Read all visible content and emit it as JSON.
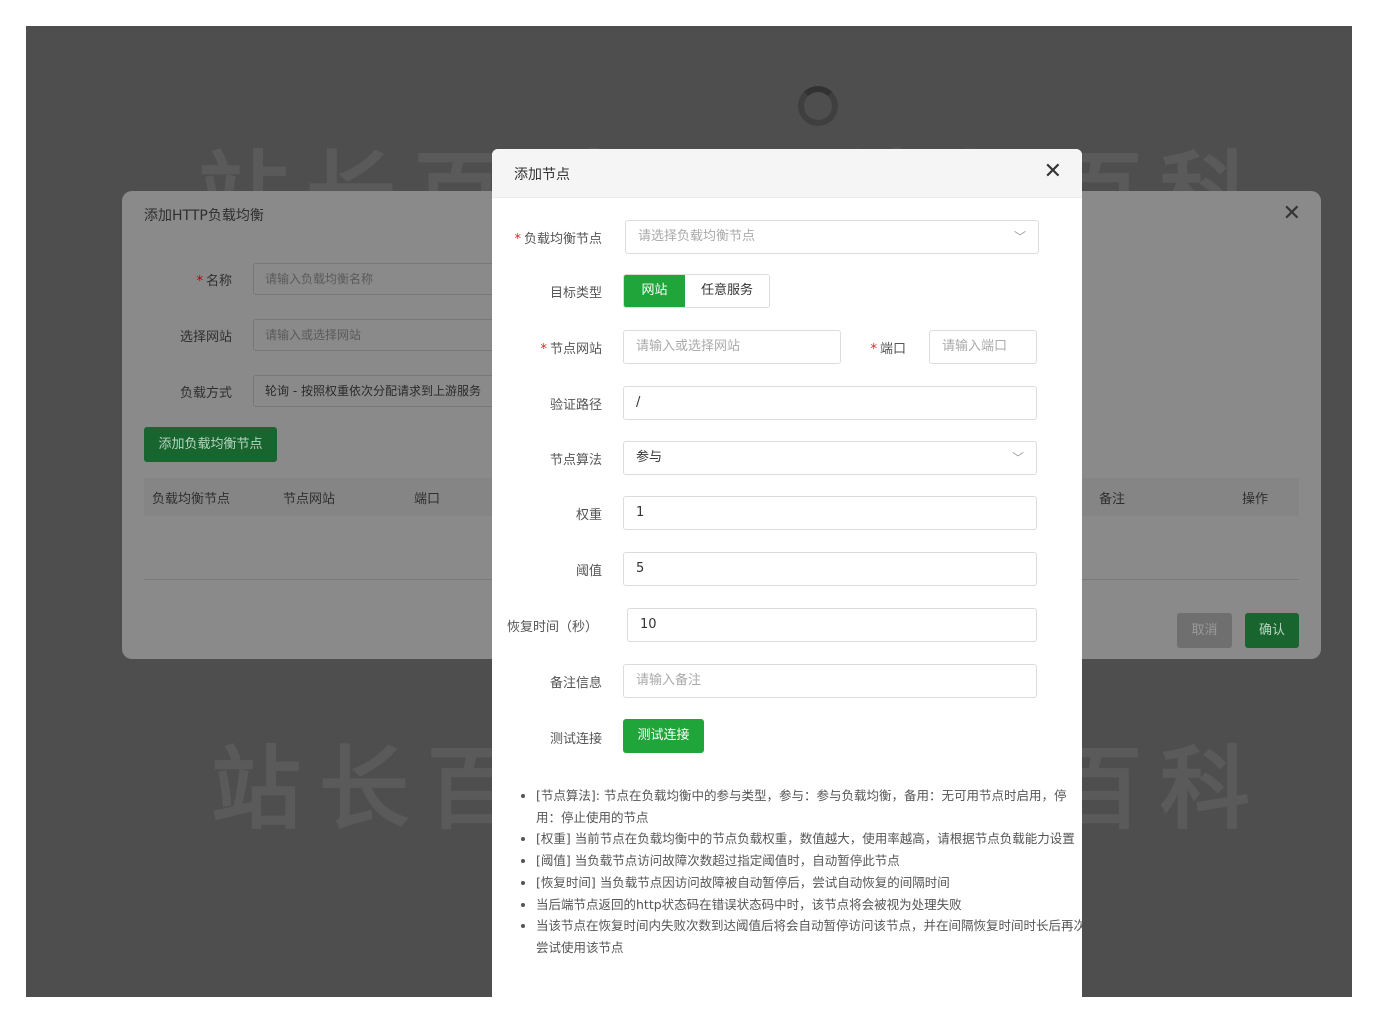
{
  "watermark": "站长百科",
  "back_dialog": {
    "title": "添加HTTP负载均衡",
    "fields": [
      {
        "label": "名称",
        "required": true,
        "placeholder": "请输入负载均衡名称",
        "value": ""
      },
      {
        "label": "选择网站",
        "required": false,
        "placeholder": "请输入或选择网站",
        "value": ""
      },
      {
        "label": "负载方式",
        "required": false,
        "placeholder": "",
        "value": "轮询 - 按照权重依次分配请求到上游服务"
      }
    ],
    "add_button": "添加负载均衡节点",
    "columns": [
      "负载均衡节点",
      "节点网站",
      "端口",
      "备注",
      "操作"
    ],
    "cancel": "取消",
    "confirm": "确认"
  },
  "dialog": {
    "title": "添加节点",
    "node": {
      "label": "负载均衡节点",
      "placeholder": "请选择负载均衡节点"
    },
    "target_type": {
      "label": "目标类型",
      "options": [
        "网站",
        "任意服务"
      ],
      "selected": "网站"
    },
    "node_site": {
      "label": "节点网站",
      "placeholder": "请输入或选择网站"
    },
    "port": {
      "label": "端口",
      "placeholder": "请输入端口"
    },
    "verify_path": {
      "label": "验证路径",
      "value": "/"
    },
    "algorithm": {
      "label": "节点算法",
      "value": "参与"
    },
    "weight": {
      "label": "权重",
      "value": "1"
    },
    "threshold": {
      "label": "阈值",
      "value": "5"
    },
    "recover_time": {
      "label": "恢复时间（秒）",
      "value": "10"
    },
    "remark": {
      "label": "备注信息",
      "placeholder": "请输入备注"
    },
    "test": {
      "label": "测试连接",
      "button": "测试连接"
    },
    "tips": [
      "[节点算法]: 节点在负载均衡中的参与类型，参与：参与负载均衡，备用：无可用节点时启用，停用：停止使用的节点",
      "[权重] 当前节点在负载均衡中的节点负载权重，数值越大，使用率越高，请根据节点负载能力设置",
      "[阈值] 当负载节点访问故障次数超过指定阈值时，自动暂停此节点",
      "[恢复时间] 当负载节点因访问故障被自动暂停后，尝试自动恢复的间隔时间",
      "当后端节点返回的http状态码在错误状态码中时，该节点将会被视为处理失败",
      "当该节点在恢复时间内失败次数到达阈值后将会自动暂停访问该节点，并在间隔恢复时间时长后再次尝试使用该节点"
    ]
  }
}
